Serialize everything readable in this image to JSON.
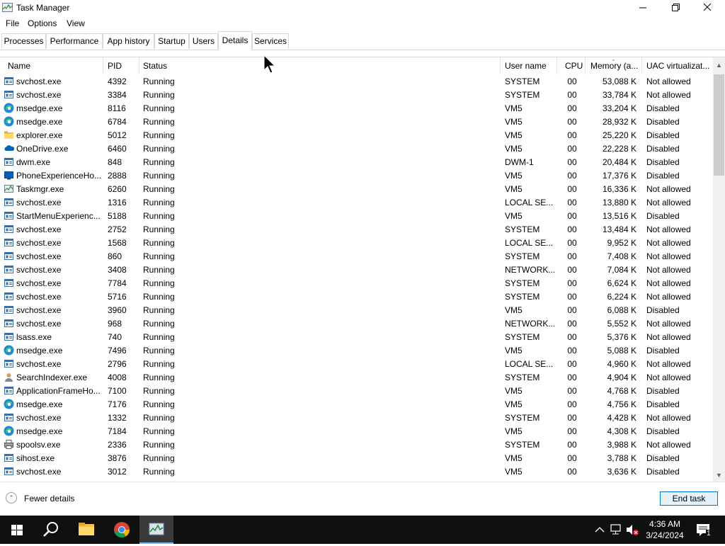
{
  "window": {
    "title": "Task Manager"
  },
  "menu": [
    "File",
    "Options",
    "View"
  ],
  "tabs": [
    "Processes",
    "Performance",
    "App history",
    "Startup",
    "Users",
    "Details",
    "Services"
  ],
  "active_tab": "Details",
  "columns": [
    "Name",
    "PID",
    "Status",
    "User name",
    "CPU",
    "Memory (a...",
    "UAC virtualizat..."
  ],
  "rows": [
    {
      "icon": "service-icon",
      "name": "svchost.exe",
      "pid": "4392",
      "status": "Running",
      "user": "SYSTEM",
      "cpu": "00",
      "mem": "53,088 K",
      "uac": "Not allowed"
    },
    {
      "icon": "service-icon",
      "name": "svchost.exe",
      "pid": "3384",
      "status": "Running",
      "user": "SYSTEM",
      "cpu": "00",
      "mem": "33,784 K",
      "uac": "Not allowed"
    },
    {
      "icon": "edge-icon",
      "name": "msedge.exe",
      "pid": "8116",
      "status": "Running",
      "user": "VM5",
      "cpu": "00",
      "mem": "33,204 K",
      "uac": "Disabled"
    },
    {
      "icon": "edge-icon",
      "name": "msedge.exe",
      "pid": "6784",
      "status": "Running",
      "user": "VM5",
      "cpu": "00",
      "mem": "28,932 K",
      "uac": "Disabled"
    },
    {
      "icon": "folder-icon",
      "name": "explorer.exe",
      "pid": "5012",
      "status": "Running",
      "user": "VM5",
      "cpu": "00",
      "mem": "25,220 K",
      "uac": "Disabled"
    },
    {
      "icon": "onedrive-icon",
      "name": "OneDrive.exe",
      "pid": "6460",
      "status": "Running",
      "user": "VM5",
      "cpu": "00",
      "mem": "22,228 K",
      "uac": "Disabled"
    },
    {
      "icon": "service-icon",
      "name": "dwm.exe",
      "pid": "848",
      "status": "Running",
      "user": "DWM-1",
      "cpu": "00",
      "mem": "20,484 K",
      "uac": "Disabled"
    },
    {
      "icon": "phone-icon",
      "name": "PhoneExperienceHo...",
      "pid": "2888",
      "status": "Running",
      "user": "VM5",
      "cpu": "00",
      "mem": "17,376 K",
      "uac": "Disabled"
    },
    {
      "icon": "taskmgr-icon",
      "name": "Taskmgr.exe",
      "pid": "6260",
      "status": "Running",
      "user": "VM5",
      "cpu": "00",
      "mem": "16,336 K",
      "uac": "Not allowed"
    },
    {
      "icon": "service-icon",
      "name": "svchost.exe",
      "pid": "1316",
      "status": "Running",
      "user": "LOCAL SE...",
      "cpu": "00",
      "mem": "13,880 K",
      "uac": "Not allowed"
    },
    {
      "icon": "service-icon",
      "name": "StartMenuExperienc...",
      "pid": "5188",
      "status": "Running",
      "user": "VM5",
      "cpu": "00",
      "mem": "13,516 K",
      "uac": "Disabled"
    },
    {
      "icon": "service-icon",
      "name": "svchost.exe",
      "pid": "2752",
      "status": "Running",
      "user": "SYSTEM",
      "cpu": "00",
      "mem": "13,484 K",
      "uac": "Not allowed"
    },
    {
      "icon": "service-icon",
      "name": "svchost.exe",
      "pid": "1568",
      "status": "Running",
      "user": "LOCAL SE...",
      "cpu": "00",
      "mem": "9,952 K",
      "uac": "Not allowed"
    },
    {
      "icon": "service-icon",
      "name": "svchost.exe",
      "pid": "860",
      "status": "Running",
      "user": "SYSTEM",
      "cpu": "00",
      "mem": "7,408 K",
      "uac": "Not allowed"
    },
    {
      "icon": "service-icon",
      "name": "svchost.exe",
      "pid": "3408",
      "status": "Running",
      "user": "NETWORK...",
      "cpu": "00",
      "mem": "7,084 K",
      "uac": "Not allowed"
    },
    {
      "icon": "service-icon",
      "name": "svchost.exe",
      "pid": "7784",
      "status": "Running",
      "user": "SYSTEM",
      "cpu": "00",
      "mem": "6,624 K",
      "uac": "Not allowed"
    },
    {
      "icon": "service-icon",
      "name": "svchost.exe",
      "pid": "5716",
      "status": "Running",
      "user": "SYSTEM",
      "cpu": "00",
      "mem": "6,224 K",
      "uac": "Not allowed"
    },
    {
      "icon": "service-icon",
      "name": "svchost.exe",
      "pid": "3960",
      "status": "Running",
      "user": "VM5",
      "cpu": "00",
      "mem": "6,088 K",
      "uac": "Disabled"
    },
    {
      "icon": "service-icon",
      "name": "svchost.exe",
      "pid": "968",
      "status": "Running",
      "user": "NETWORK...",
      "cpu": "00",
      "mem": "5,552 K",
      "uac": "Not allowed"
    },
    {
      "icon": "service-icon",
      "name": "lsass.exe",
      "pid": "740",
      "status": "Running",
      "user": "SYSTEM",
      "cpu": "00",
      "mem": "5,376 K",
      "uac": "Not allowed"
    },
    {
      "icon": "edge-icon",
      "name": "msedge.exe",
      "pid": "7496",
      "status": "Running",
      "user": "VM5",
      "cpu": "00",
      "mem": "5,088 K",
      "uac": "Disabled"
    },
    {
      "icon": "service-icon",
      "name": "svchost.exe",
      "pid": "2796",
      "status": "Running",
      "user": "LOCAL SE...",
      "cpu": "00",
      "mem": "4,960 K",
      "uac": "Not allowed"
    },
    {
      "icon": "search-indexer-icon",
      "name": "SearchIndexer.exe",
      "pid": "4008",
      "status": "Running",
      "user": "SYSTEM",
      "cpu": "00",
      "mem": "4,904 K",
      "uac": "Not allowed"
    },
    {
      "icon": "service-icon",
      "name": "ApplicationFrameHo...",
      "pid": "7100",
      "status": "Running",
      "user": "VM5",
      "cpu": "00",
      "mem": "4,768 K",
      "uac": "Disabled"
    },
    {
      "icon": "edge-icon",
      "name": "msedge.exe",
      "pid": "7176",
      "status": "Running",
      "user": "VM5",
      "cpu": "00",
      "mem": "4,756 K",
      "uac": "Disabled"
    },
    {
      "icon": "service-icon",
      "name": "svchost.exe",
      "pid": "1332",
      "status": "Running",
      "user": "SYSTEM",
      "cpu": "00",
      "mem": "4,428 K",
      "uac": "Not allowed"
    },
    {
      "icon": "edge-icon",
      "name": "msedge.exe",
      "pid": "7184",
      "status": "Running",
      "user": "VM5",
      "cpu": "00",
      "mem": "4,308 K",
      "uac": "Disabled"
    },
    {
      "icon": "printer-icon",
      "name": "spoolsv.exe",
      "pid": "2336",
      "status": "Running",
      "user": "SYSTEM",
      "cpu": "00",
      "mem": "3,988 K",
      "uac": "Not allowed"
    },
    {
      "icon": "service-icon",
      "name": "sihost.exe",
      "pid": "3876",
      "status": "Running",
      "user": "VM5",
      "cpu": "00",
      "mem": "3,788 K",
      "uac": "Disabled"
    },
    {
      "icon": "service-icon",
      "name": "svchost.exe",
      "pid": "3012",
      "status": "Running",
      "user": "VM5",
      "cpu": "00",
      "mem": "3,636 K",
      "uac": "Disabled"
    }
  ],
  "footer": {
    "fewer_details": "Fewer details",
    "end_task": "End task"
  },
  "taskbar": {
    "apps": [
      "start-icon",
      "search-icon",
      "file-explorer-icon",
      "chrome-icon",
      "task-manager-icon"
    ],
    "clock_time": "4:36 AM",
    "clock_date": "3/24/2024",
    "notification_count": "1"
  },
  "colors": {
    "selected_border": "#0078d7",
    "taskbar_bg": "#101010",
    "edge_blue": "#1e88d2",
    "folder_yellow": "#f3c14b"
  }
}
